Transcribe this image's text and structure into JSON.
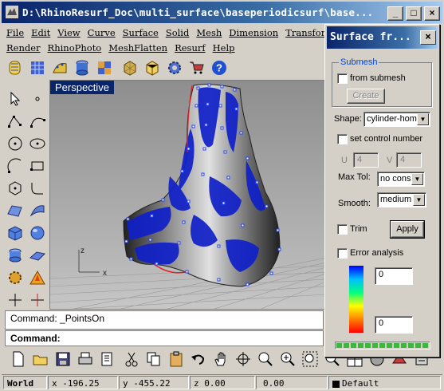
{
  "window": {
    "title": "D:\\RhinoResurf_Doc\\multi_surface\\baseperiodicsurf\\base...",
    "minimize": "_",
    "maximize": "□",
    "close": "×"
  },
  "menu_row1": [
    "File",
    "Edit",
    "View",
    "Curve",
    "Surface",
    "Solid",
    "Mesh",
    "Dimension",
    "Transform"
  ],
  "menu_row2": [
    "Render",
    "RhinoPhoto",
    "MeshFlatten",
    "Resurf",
    "Help"
  ],
  "viewport": {
    "label": "Perspective",
    "axis_z": "z",
    "axis_x": "x"
  },
  "command": {
    "history": "Command: _PointsOn",
    "prompt": "Command:"
  },
  "status": {
    "cplane": "World",
    "x": "x -196.25",
    "y": "y -455.22",
    "z": "z 0.00",
    "value": "0.00",
    "layer": "Default"
  },
  "dialog": {
    "title": "Surface fr...",
    "close": "×",
    "submesh_group": "Submesh",
    "from_submesh": "from submesh",
    "create_button": "Create",
    "shape_label": "Shape:",
    "shape_value": "cylinder-hom",
    "set_control_number": "set control number",
    "u_label": "U",
    "u_value": "4",
    "v_label": "V",
    "v_value": "4",
    "max_tol_label": "Max Tol:",
    "max_tol_value": "no cons",
    "smooth_label": "Smooth:",
    "smooth_value": "medium",
    "trim_label": "Trim",
    "apply_button": "Apply",
    "error_analysis": "Error analysis",
    "legend_max": "0",
    "legend_min": "0"
  },
  "colors": {
    "title_bar": "#0a246a",
    "viewport_label": "#0a246a",
    "surface_blue": "#1020c8",
    "control_points": "#3050ff",
    "progress_fill": "#3cb83c"
  }
}
